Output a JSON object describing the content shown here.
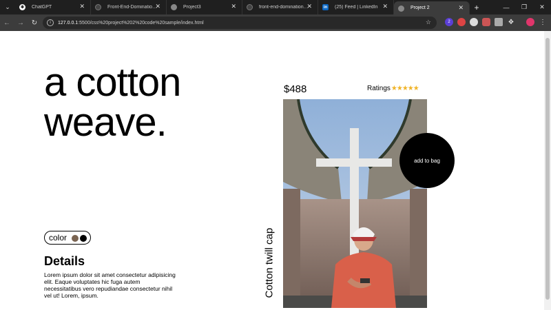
{
  "browser": {
    "tabs": [
      {
        "label": "ChatGPT",
        "favicon": "chatgpt-icon",
        "active": false
      },
      {
        "label": "Front-End-Domination-W",
        "favicon": "github-icon",
        "active": false
      },
      {
        "label": "Project3",
        "favicon": "globe-icon",
        "active": false
      },
      {
        "label": "front-end-domination/css",
        "favicon": "github-icon",
        "active": false
      },
      {
        "label": "(25) Feed | LinkedIn",
        "favicon": "linkedin-icon",
        "active": false
      },
      {
        "label": "Project 2",
        "favicon": "globe-icon",
        "active": true
      }
    ],
    "url_host": "127.0.0.1",
    "url_rest": ":5500/css%20project%202%20code%20sample/index.html",
    "extension_badge": "2"
  },
  "product": {
    "headline_line1": "a cotton",
    "headline_line2": "weave.",
    "price": "$488",
    "ratings_label": "Ratings",
    "rating_value": 5,
    "rating_max": 5,
    "color_label": "color",
    "swatches": [
      "#7a6452",
      "#000000"
    ],
    "details_title": "Details",
    "details_text": "Lorem ipsum dolor sit amet consectetur adipisicing elit. Eaque voluptates hic fuga autem necessitatibus vero repudiandae consectetur nihil vel ut! Lorem, ipsum.",
    "product_name": "Cotton twill cap",
    "add_to_bag_label": "add to bag"
  }
}
